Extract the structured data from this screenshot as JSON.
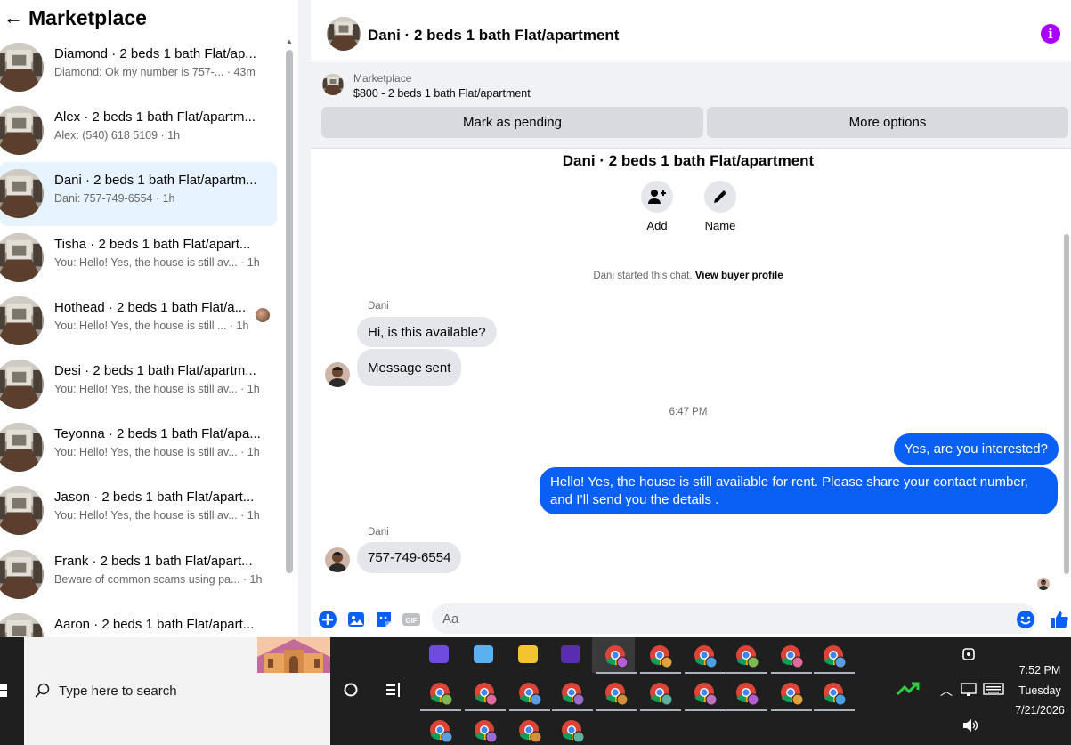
{
  "sidebar": {
    "back": "←",
    "title": "Marketplace",
    "conversations": [
      {
        "name": "Diamond · 2 beds 1 bath Flat/ap...",
        "snippet": "Diamond: Ok my number is 757-... · 43m",
        "active": false
      },
      {
        "name": "Alex · 2 beds 1 bath Flat/apartm...",
        "snippet": "Alex: (540) 618 5109 · 1h",
        "active": false
      },
      {
        "name": "Dani · 2 beds 1 bath Flat/apartm...",
        "snippet": "Dani: 757-749-6554 · 1h",
        "active": true
      },
      {
        "name": "Tisha · 2 beds 1 bath Flat/apart...",
        "snippet": "You: Hello! Yes, the house is still av... · 1h",
        "active": false
      },
      {
        "name": "Hothead · 2 beds 1 bath Flat/a...",
        "snippet": "You: Hello! Yes, the house is still ... · 1h",
        "active": false
      },
      {
        "name": "Desi · 2 beds 1 bath Flat/apartm...",
        "snippet": "You: Hello! Yes, the house is still av... · 1h",
        "active": false
      },
      {
        "name": "Teyonna · 2 beds 1 bath Flat/apa...",
        "snippet": "You: Hello! Yes, the house is still av... · 1h",
        "active": false
      },
      {
        "name": "Jason · 2 beds 1 bath Flat/apart...",
        "snippet": "You: Hello! Yes, the house is still av... · 1h",
        "active": false
      },
      {
        "name": "Frank · 2 beds 1 bath Flat/apart...",
        "snippet": "Beware of common scams using pa... · 1h",
        "active": false
      },
      {
        "name": "Aaron · 2 beds 1 bath Flat/apart...",
        "snippet": "",
        "active": false
      }
    ]
  },
  "chat": {
    "header_title": "Dani · 2 beds 1 bath Flat/apartment",
    "marketplace_label": "Marketplace",
    "listing": "$800 - 2 beds 1 bath Flat/apartment",
    "mark_pending": "Mark as pending",
    "more_options": "More options",
    "conversation_title": "Dani · 2 beds 1 bath Flat/apartment",
    "add_label": "Add",
    "name_label": "Name",
    "started_text": "Dani started this chat.",
    "view_profile": "View buyer profile",
    "sender_name": "Dani",
    "messages_in_1": [
      "Hi, is this available?",
      "Message sent"
    ],
    "timestamp": "6:47 PM",
    "messages_out": [
      "Yes, are you interested?",
      "Hello! Yes, the house is still available for rent. Please share your contact number, and I’ll send you the details ."
    ],
    "message_in_2": "757-749-6554",
    "composer_placeholder": "Aa"
  },
  "taskbar": {
    "search_placeholder": "Type here to search",
    "time": "7:52 PM",
    "day": "Tuesday",
    "date": "7/21/2026"
  },
  "colors": {
    "accent_blue": "#0a60f5",
    "info_purple": "#a700ff",
    "active_row": "#e7f3ff"
  }
}
